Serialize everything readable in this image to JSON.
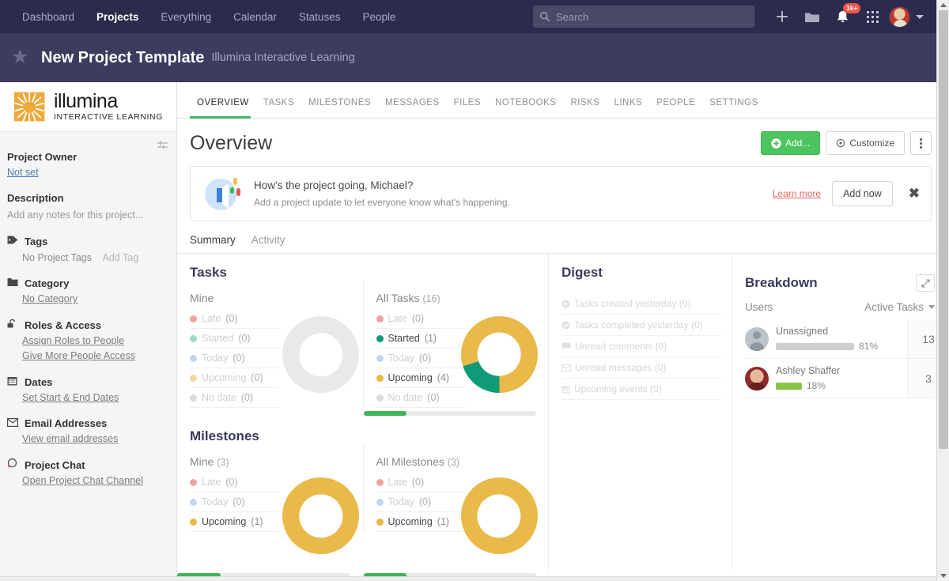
{
  "topnav": {
    "links": [
      {
        "label": "Dashboard",
        "active": false
      },
      {
        "label": "Projects",
        "active": true
      },
      {
        "label": "Everything",
        "active": false
      },
      {
        "label": "Calendar",
        "active": false
      },
      {
        "label": "Statuses",
        "active": false
      },
      {
        "label": "People",
        "active": false
      }
    ],
    "search_placeholder": "Search",
    "search_value": "",
    "notification_badge": "1k+",
    "icons": [
      "search-icon",
      "plus-icon",
      "folder-icon",
      "bell-icon",
      "grid-apps-icon",
      "avatar",
      "chevron-down-icon"
    ]
  },
  "project_header": {
    "title": "New Project Template",
    "subtitle": "Illumina Interactive Learning",
    "star_icon": "star-icon"
  },
  "sidebar": {
    "logo_main": "illumina",
    "logo_tagline": "INTERACTIVE LEARNING",
    "collapse_icon": "collapse-panel-icon",
    "blocks": [
      {
        "title": "Project Owner",
        "icon": "",
        "link": "Not set",
        "link_style": "blue"
      },
      {
        "title": "Description",
        "icon": "",
        "placeholder": "Add any notes for this project..."
      },
      {
        "title": "Tags",
        "icon": "tag-icon",
        "value": "No Project Tags",
        "action": "Add Tag"
      },
      {
        "title": "Category",
        "icon": "folder-icon",
        "links": [
          "No Category"
        ]
      },
      {
        "title": "Roles & Access",
        "icon": "unlock-icon",
        "links": [
          "Assign Roles to People",
          "Give More People Access"
        ]
      },
      {
        "title": "Dates",
        "icon": "calendar-icon",
        "links": [
          "Set Start & End Dates"
        ]
      },
      {
        "title": "Email Addresses",
        "icon": "envelope-icon",
        "links": [
          "View email addresses"
        ]
      },
      {
        "title": "Project Chat",
        "icon": "chat-icon",
        "links": [
          "Open Project Chat Channel"
        ]
      }
    ]
  },
  "tabs": [
    {
      "label": "OVERVIEW",
      "active": true
    },
    {
      "label": "TASKS",
      "active": false
    },
    {
      "label": "MILESTONES",
      "active": false
    },
    {
      "label": "MESSAGES",
      "active": false
    },
    {
      "label": "FILES",
      "active": false
    },
    {
      "label": "NOTEBOOKS",
      "active": false
    },
    {
      "label": "RISKS",
      "active": false
    },
    {
      "label": "LINKS",
      "active": false
    },
    {
      "label": "PEOPLE",
      "active": false
    },
    {
      "label": "SETTINGS",
      "active": false
    }
  ],
  "overview": {
    "title": "Overview",
    "add_button": "Add...",
    "customize_button": "Customize",
    "kebab": "more-options"
  },
  "banner": {
    "headline": "How's the project going, Michael?",
    "subtext": "Add a project update to let everyone know what's happening.",
    "learn_more": "Learn more",
    "add_now": "Add now",
    "close": "✖"
  },
  "subtabs": [
    {
      "label": "Summary",
      "active": true
    },
    {
      "label": "Activity",
      "active": false
    }
  ],
  "tasks_widget": {
    "title": "Tasks",
    "mine": {
      "heading": "Mine",
      "count": "",
      "rows": [
        {
          "label": "Late",
          "count": "(0)",
          "color": "#f0a1a1",
          "on": false
        },
        {
          "label": "Started",
          "count": "(0)",
          "color": "#9ed9c8",
          "on": false
        },
        {
          "label": "Today",
          "count": "(0)",
          "color": "#bdd9f2",
          "on": false
        },
        {
          "label": "Upcoming",
          "count": "(0)",
          "color": "#f5d99a",
          "on": false
        },
        {
          "label": "No date",
          "count": "(0)",
          "color": "#d8d8d8",
          "on": false
        }
      ]
    },
    "all": {
      "heading": "All Tasks",
      "count": "(16)",
      "rows": [
        {
          "label": "Late",
          "count": "(0)",
          "color": "#f0a1a1",
          "on": false
        },
        {
          "label": "Started",
          "count": "(1)",
          "color": "#0f9b78",
          "on": true
        },
        {
          "label": "Today",
          "count": "(0)",
          "color": "#bdd9f2",
          "on": false
        },
        {
          "label": "Upcoming",
          "count": "(4)",
          "color": "#e9b949",
          "on": true
        },
        {
          "label": "No date",
          "count": "(0)",
          "color": "#d8d8d8",
          "on": false
        }
      ]
    }
  },
  "milestones_widget": {
    "title": "Milestones",
    "mine": {
      "heading": "Mine",
      "count": "(3)",
      "rows": [
        {
          "label": "Late",
          "count": "(0)",
          "color": "#f0a1a1",
          "on": false
        },
        {
          "label": "Today",
          "count": "(0)",
          "color": "#bdd9f2",
          "on": false
        },
        {
          "label": "Upcoming",
          "count": "(1)",
          "color": "#e9b949",
          "on": true
        }
      ]
    },
    "all": {
      "heading": "All Milestones",
      "count": "(3)",
      "rows": [
        {
          "label": "Late",
          "count": "(0)",
          "color": "#f0a1a1",
          "on": false
        },
        {
          "label": "Today",
          "count": "(0)",
          "color": "#bdd9f2",
          "on": false
        },
        {
          "label": "Upcoming",
          "count": "(1)",
          "color": "#e9b949",
          "on": true
        }
      ]
    }
  },
  "digest": {
    "title": "Digest",
    "rows": [
      {
        "icon": "plus-circle-icon",
        "label": "Tasks created yesterday (0)"
      },
      {
        "icon": "check-circle-icon",
        "label": "Tasks completed yesterday (0)"
      },
      {
        "icon": "comment-icon",
        "label": "Unread comments (0)"
      },
      {
        "icon": "envelope-icon",
        "label": "Unread messages (0)"
      },
      {
        "icon": "calendar-icon",
        "label": "Upcoming events (0)"
      }
    ]
  },
  "breakdown": {
    "title": "Breakdown",
    "expand_icon": "expand-icon",
    "col_users": "Users",
    "col_metric": "Active Tasks",
    "rows": [
      {
        "name": "Unassigned",
        "percent": "81%",
        "bar_pct": 81,
        "bar_color": "#cfcfcf",
        "count": "13",
        "avatar": "unassigned"
      },
      {
        "name": "Ashley Shaffer",
        "percent": "18%",
        "bar_pct": 18,
        "bar_color": "#8ac34a",
        "count": "3",
        "avatar": "ashley"
      }
    ]
  },
  "chart_data": [
    {
      "type": "pie",
      "title": "Tasks — Mine",
      "categories": [
        "Late",
        "Started",
        "Today",
        "Upcoming",
        "No date"
      ],
      "values": [
        0,
        0,
        0,
        0,
        0
      ],
      "colors": [
        "#f0a1a1",
        "#9ed9c8",
        "#bdd9f2",
        "#f5d99a",
        "#e9e9e9"
      ],
      "total": 0,
      "empty": true
    },
    {
      "type": "pie",
      "title": "Tasks — All Tasks (16)",
      "categories": [
        "Late",
        "Started",
        "Today",
        "Upcoming",
        "No date"
      ],
      "values": [
        0,
        1,
        0,
        4,
        0
      ],
      "colors": [
        "#f0a1a1",
        "#0f9b78",
        "#bdd9f2",
        "#e9b949",
        "#e9e9e9"
      ],
      "total": 16,
      "segments": [
        {
          "name": "Started",
          "value": 1,
          "share_pct": 20,
          "color": "#0f9b78"
        },
        {
          "name": "Upcoming",
          "value": 4,
          "share_pct": 80,
          "color": "#e9b949"
        }
      ],
      "progress_pct": 25
    },
    {
      "type": "pie",
      "title": "Milestones — Mine (3)",
      "categories": [
        "Late",
        "Today",
        "Upcoming"
      ],
      "values": [
        0,
        0,
        1
      ],
      "colors": [
        "#f0a1a1",
        "#bdd9f2",
        "#e9b949"
      ],
      "total": 3,
      "segments": [
        {
          "name": "Upcoming",
          "value": 1,
          "share_pct": 100,
          "color": "#e9b949"
        }
      ],
      "progress_pct": 25
    },
    {
      "type": "pie",
      "title": "Milestones — All Milestones (3)",
      "categories": [
        "Late",
        "Today",
        "Upcoming"
      ],
      "values": [
        0,
        0,
        1
      ],
      "colors": [
        "#f0a1a1",
        "#bdd9f2",
        "#e9b949"
      ],
      "total": 3,
      "segments": [
        {
          "name": "Upcoming",
          "value": 1,
          "share_pct": 100,
          "color": "#e9b949"
        }
      ],
      "progress_pct": 25
    },
    {
      "type": "bar",
      "title": "Breakdown — Active Tasks by User",
      "categories": [
        "Unassigned",
        "Ashley Shaffer"
      ],
      "values": [
        13,
        3
      ],
      "percent_values": [
        81,
        18
      ],
      "xlabel": "",
      "ylabel": "Active Tasks"
    }
  ]
}
